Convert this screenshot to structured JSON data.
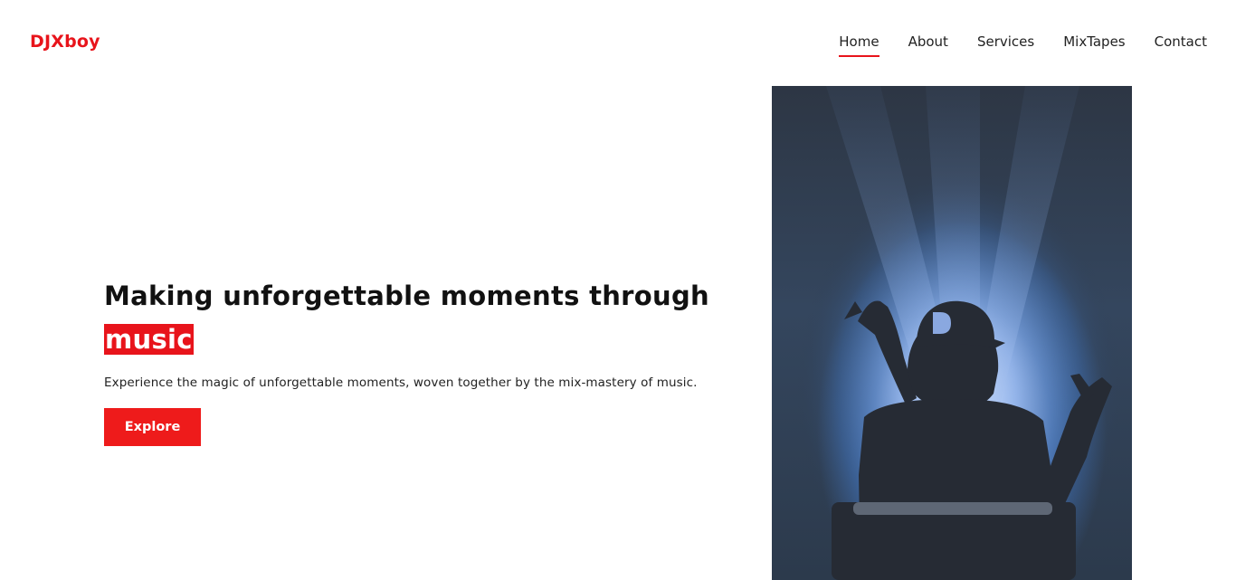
{
  "brand": {
    "logo": "DJXboy",
    "accent_color": "#e8141b"
  },
  "nav": {
    "items": [
      {
        "label": "Home",
        "active": true
      },
      {
        "label": "About",
        "active": false
      },
      {
        "label": "Services",
        "active": false
      },
      {
        "label": "MixTapes",
        "active": false
      },
      {
        "label": "Contact",
        "active": false
      }
    ]
  },
  "hero": {
    "title_main": "Making unforgettable moments through",
    "title_highlight": "music",
    "subtitle": "Experience the magic of unforgettable moments, woven together by the mix-mastery of music.",
    "cta_label": "Explore",
    "image_icon": "dj-performer-photo",
    "cap_logo": "D"
  }
}
